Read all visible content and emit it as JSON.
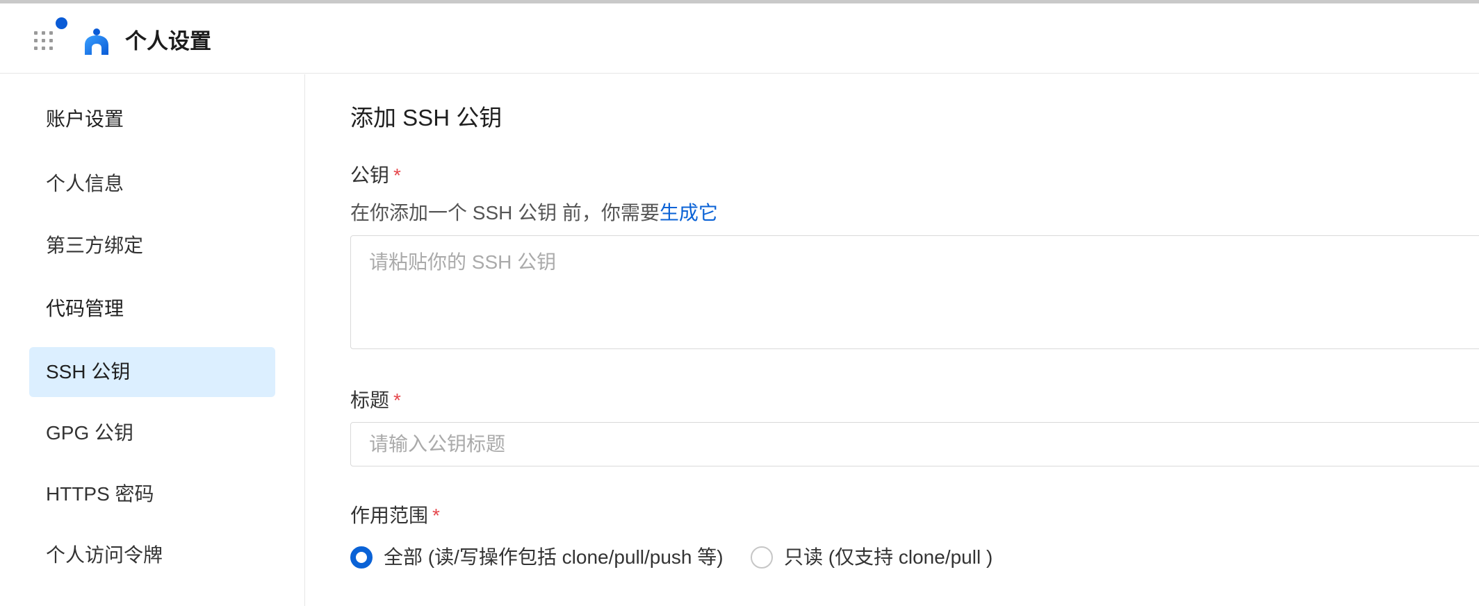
{
  "header": {
    "title": "个人设置",
    "apps_icon": "apps-grid-icon",
    "logo_icon": "person-logo-icon",
    "accent_color": "#0a5bd6"
  },
  "sidebar": {
    "items": [
      {
        "label": "账户设置",
        "kind": "section"
      },
      {
        "label": "个人信息",
        "kind": "item"
      },
      {
        "label": "第三方绑定",
        "kind": "item"
      },
      {
        "label": "代码管理",
        "kind": "section"
      },
      {
        "label": "SSH 公钥",
        "kind": "item",
        "active": true
      },
      {
        "label": "GPG 公钥",
        "kind": "item"
      },
      {
        "label": "HTTPS 密码",
        "kind": "item"
      },
      {
        "label": "个人访问令牌",
        "kind": "item"
      }
    ],
    "active_bg": "#dcefff"
  },
  "form": {
    "title": "添加 SSH 公钥",
    "key_label": "公钥",
    "required_mark": "*",
    "hint_prefix": "在你添加一个 SSH 公钥 前，你需要",
    "hint_link": "生成它",
    "key_placeholder": "请粘贴你的 SSH 公钥",
    "key_value": "",
    "title_label": "标题",
    "title_placeholder": "请输入公钥标题",
    "title_value": "",
    "scope_label": "作用范围",
    "scope_options": [
      {
        "label": "全部 (读/写操作包括 clone/pull/push 等)",
        "checked": true
      },
      {
        "label": "只读 (仅支持 clone/pull )",
        "checked": false
      }
    ],
    "link_color": "#0a62d6",
    "required_color": "#e5484d"
  }
}
